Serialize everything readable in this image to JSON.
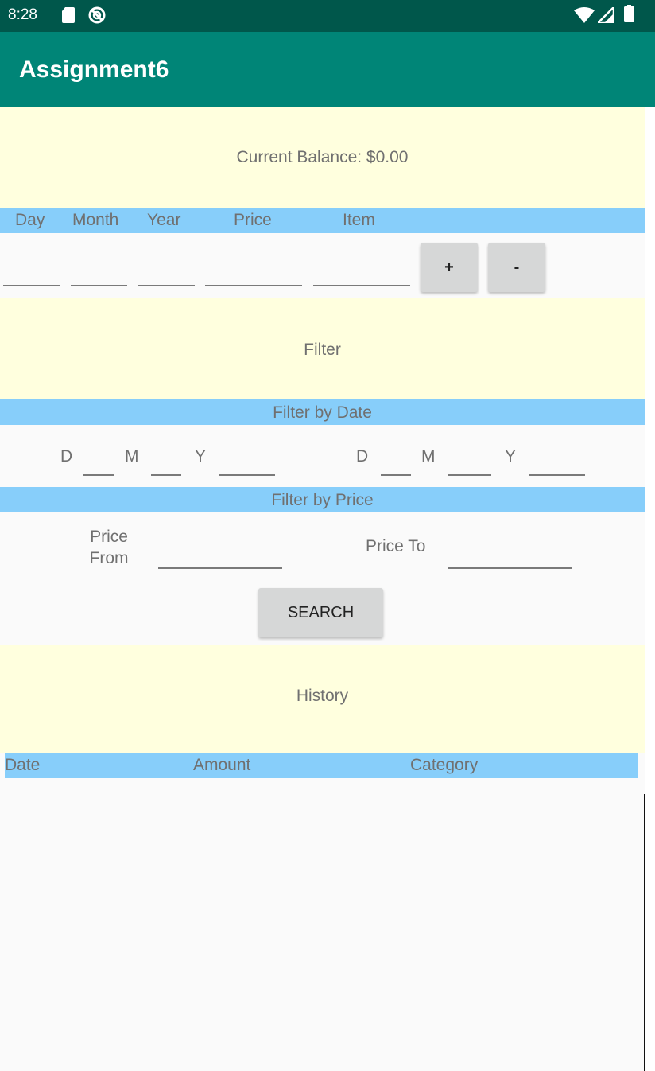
{
  "status_bar": {
    "time": "8:28",
    "icons": [
      "sd-card-icon",
      "sync-icon",
      "wifi-icon",
      "signal-icon",
      "battery-icon"
    ]
  },
  "app_bar": {
    "title": "Assignment6"
  },
  "balance": {
    "text": "Current Balance: $0.00"
  },
  "entry_header": {
    "columns": [
      "Day",
      "Month",
      "Year",
      "Price",
      "Item"
    ]
  },
  "entry": {
    "fields": [
      {
        "name": "day",
        "value": ""
      },
      {
        "name": "month",
        "value": ""
      },
      {
        "name": "year",
        "value": ""
      },
      {
        "name": "price",
        "value": ""
      },
      {
        "name": "item",
        "value": ""
      }
    ],
    "add_label": "+",
    "remove_label": "-"
  },
  "filter": {
    "title": "Filter",
    "by_date_label": "Filter by Date",
    "date_from": {
      "d_label": "D",
      "m_label": "M",
      "y_label": "Y"
    },
    "date_to": {
      "d_label": "D",
      "m_label": "M",
      "y_label": "Y"
    },
    "by_price_label": "Filter by Price",
    "price_from_label_1": "Price",
    "price_from_label_2": "From",
    "price_to_label": "Price To",
    "search_label": "SEARCH"
  },
  "history": {
    "title": "History",
    "columns": [
      "Date",
      "Amount",
      "Category"
    ],
    "rows": []
  },
  "colors": {
    "status_bar": "#00574b",
    "app_bar": "#008577",
    "section_bg": "#ffffde",
    "band_bg": "#87cefa"
  }
}
